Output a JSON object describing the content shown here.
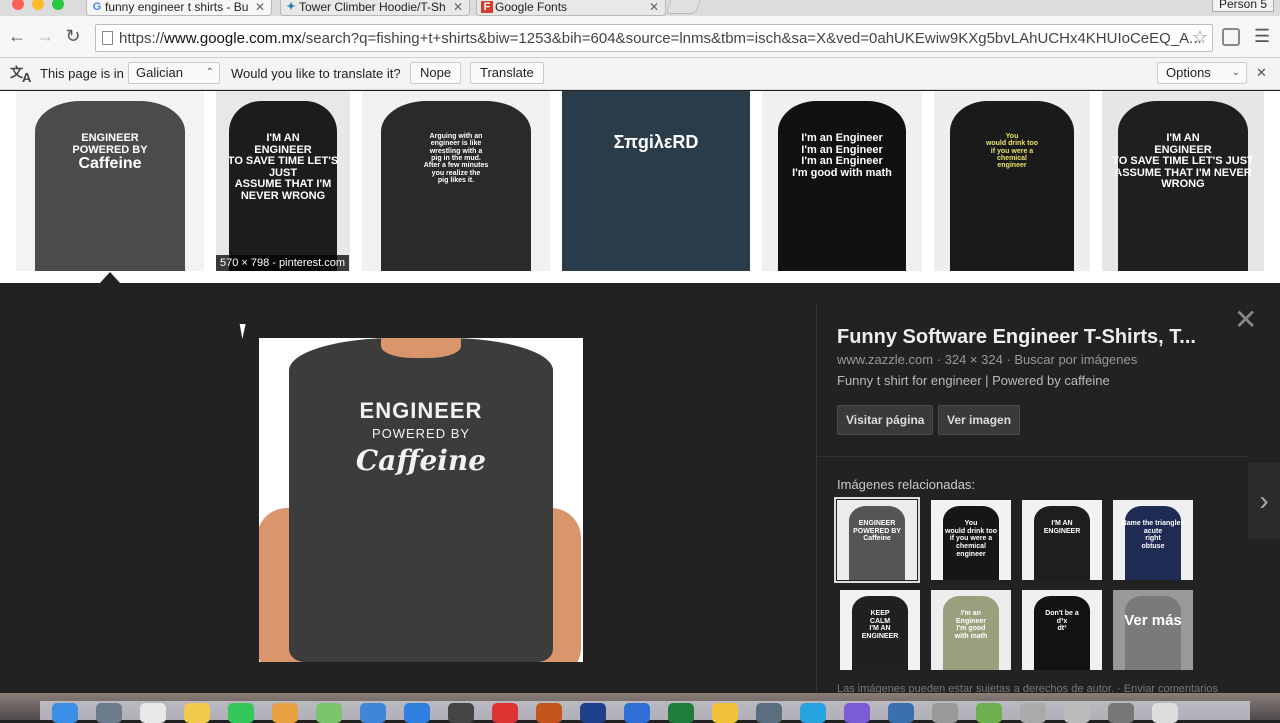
{
  "browser": {
    "tabs": [
      {
        "label": "funny engineer t shirts - Bu",
        "favicon": "G",
        "active": true
      },
      {
        "label": "Tower Climber Hoodie/T-Sh",
        "favicon": "✦",
        "active": false
      },
      {
        "label": "Google Fonts",
        "favicon": "F",
        "active": false
      }
    ],
    "profile": "Person 5",
    "url_prefix": "https://",
    "url_host": "www.google.com.mx",
    "url_rest": "/search?q=fishing+t+shirts&biw=1253&bih=604&source=lnms&tbm=isch&sa=X&ved=0ahUKEwiw9KXg5bvLAhUCHx4KHUIoCeEQ_A...",
    "icons": {
      "back": "back-arrow-icon",
      "forward": "forward-arrow-icon",
      "reload": "reload-icon",
      "star": "bookmark-star-icon",
      "menu": "hamburger-menu-icon"
    }
  },
  "translate_bar": {
    "prefix": "This page is in",
    "language": "Galician",
    "question": "Would you like to translate it?",
    "nope": "Nope",
    "translate": "Translate",
    "options": "Options"
  },
  "results": {
    "thumbs": [
      {
        "lines": [
          "ENGINEER",
          "POWERED BY",
          "Caffeine"
        ],
        "shirt": "#4b4b4b",
        "bg": "#f3f3f3"
      },
      {
        "lines": [
          "I'M AN",
          "ENGINEER",
          "TO SAVE TIME LET'S JUST",
          "ASSUME THAT I'M NEVER WRONG"
        ],
        "shirt": "#1c1c1c",
        "bg": "#e8e8e8"
      },
      {
        "lines": [
          "Arguing with an",
          "engineer is like",
          "wrestling with a",
          "pig in the mud.",
          "After a few minutes",
          "you realize the",
          "pig likes it."
        ],
        "shirt": "#2a2a2a",
        "bg": "#f1f1f1"
      },
      {
        "lines": [
          "ΣπgiλεRD"
        ],
        "shirt": "#2a3b4a",
        "bg": "#2a3b4a"
      },
      {
        "lines": [
          "I'm an Engineer",
          "I'm an Engineer",
          "I'm an Engineer",
          "I'm good with math"
        ],
        "shirt": "#111111",
        "bg": "#f0f0f0"
      },
      {
        "lines": [
          "You",
          "would drink too",
          "if you were a",
          "chemical",
          "engineer"
        ],
        "shirt": "#1a1a1a",
        "bg": "#eeeeee"
      },
      {
        "lines": [
          "I'M AN",
          "ENGINEER",
          "TO SAVE TIME LET'S JUST",
          "ASSUME THAT I'M NEVER WRONG"
        ],
        "shirt": "#1f1f1f",
        "bg": "#e6e6e6"
      }
    ],
    "caption": "570 × 798 - pinterest.com"
  },
  "viewer": {
    "main_lines": [
      "ENGINEER",
      "POWERED BY",
      "Caffeine"
    ],
    "title": "Funny Software Engineer T-Shirts, T...",
    "meta": "www.zazzle.com  ·  324 × 324  ·  Buscar por imágenes",
    "description": "Funny t shirt for engineer | Powered by caffeine",
    "visit": "Visitar página",
    "view": "Ver imagen",
    "related_label": "Imágenes relacionadas:",
    "related": [
      {
        "lines": [
          "ENGINEER",
          "POWERED BY",
          "Caffeine"
        ],
        "shirt": "#555555",
        "bg": "#ececec"
      },
      {
        "lines": [
          "You",
          "would drink too",
          "if you were a",
          "chemical",
          "engineer"
        ],
        "shirt": "#161616",
        "bg": "#f2f2f2"
      },
      {
        "lines": [
          "I'M AN",
          "ENGINEER"
        ],
        "shirt": "#1e1e1e",
        "bg": "#f2f2f2"
      },
      {
        "lines": [
          "Name the triangles",
          "acute",
          "right",
          "obtuse"
        ],
        "shirt": "#1f2b52",
        "bg": "#eef0f3"
      },
      {
        "lines": [
          "KEEP",
          "CALM",
          "I'M AN",
          "ENGINEER"
        ],
        "shirt": "#202020",
        "bg": "#f1f1f1"
      },
      {
        "lines": [
          "I'm an",
          "Engineer",
          "I'm good",
          "with math"
        ],
        "shirt": "#9aa07e",
        "bg": "#ededed"
      },
      {
        "lines": [
          "Don't be a",
          "d³x",
          "dt³"
        ],
        "shirt": "#121212",
        "bg": "#f0f0f0"
      }
    ],
    "more": "Ver más",
    "footer": "Las imágenes pueden estar sujetas a derechos de autor.  ·  Enviar comentarios"
  }
}
